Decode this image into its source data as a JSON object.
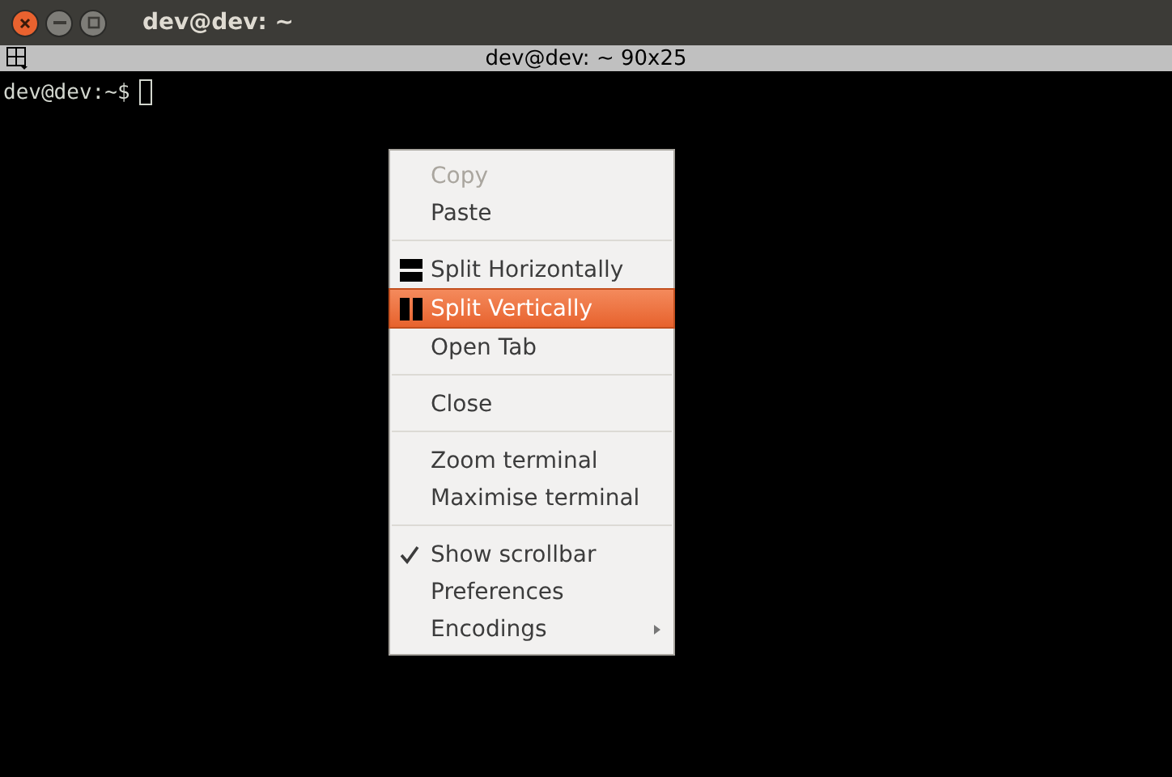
{
  "window": {
    "title": "dev@dev: ~"
  },
  "tab_bar": {
    "title": "dev@dev: ~ 90x25"
  },
  "terminal": {
    "prompt": "dev@dev:~$"
  },
  "context_menu": [
    {
      "kind": "item",
      "label": "Copy",
      "disabled": true,
      "selected": false
    },
    {
      "kind": "item",
      "label": "Paste",
      "disabled": false,
      "selected": false
    },
    {
      "kind": "separator"
    },
    {
      "kind": "split-horizontal",
      "label": "Split Horizontally",
      "disabled": false,
      "selected": false
    },
    {
      "kind": "split-vertical",
      "label": "Split Vertically",
      "disabled": false,
      "selected": true
    },
    {
      "kind": "item",
      "label": "Open Tab",
      "disabled": false,
      "selected": false
    },
    {
      "kind": "separator"
    },
    {
      "kind": "item",
      "label": "Close",
      "disabled": false,
      "selected": false
    },
    {
      "kind": "separator"
    },
    {
      "kind": "item",
      "label": "Zoom terminal",
      "disabled": false,
      "selected": false
    },
    {
      "kind": "item",
      "label": "Maximise terminal",
      "disabled": false,
      "selected": false
    },
    {
      "kind": "separator"
    },
    {
      "kind": "item",
      "label": "Show scrollbar",
      "disabled": false,
      "selected": false,
      "checked": true
    },
    {
      "kind": "item",
      "label": "Preferences",
      "disabled": false,
      "selected": false
    },
    {
      "kind": "item",
      "label": "Encodings",
      "disabled": false,
      "selected": false,
      "submenu": true
    }
  ]
}
